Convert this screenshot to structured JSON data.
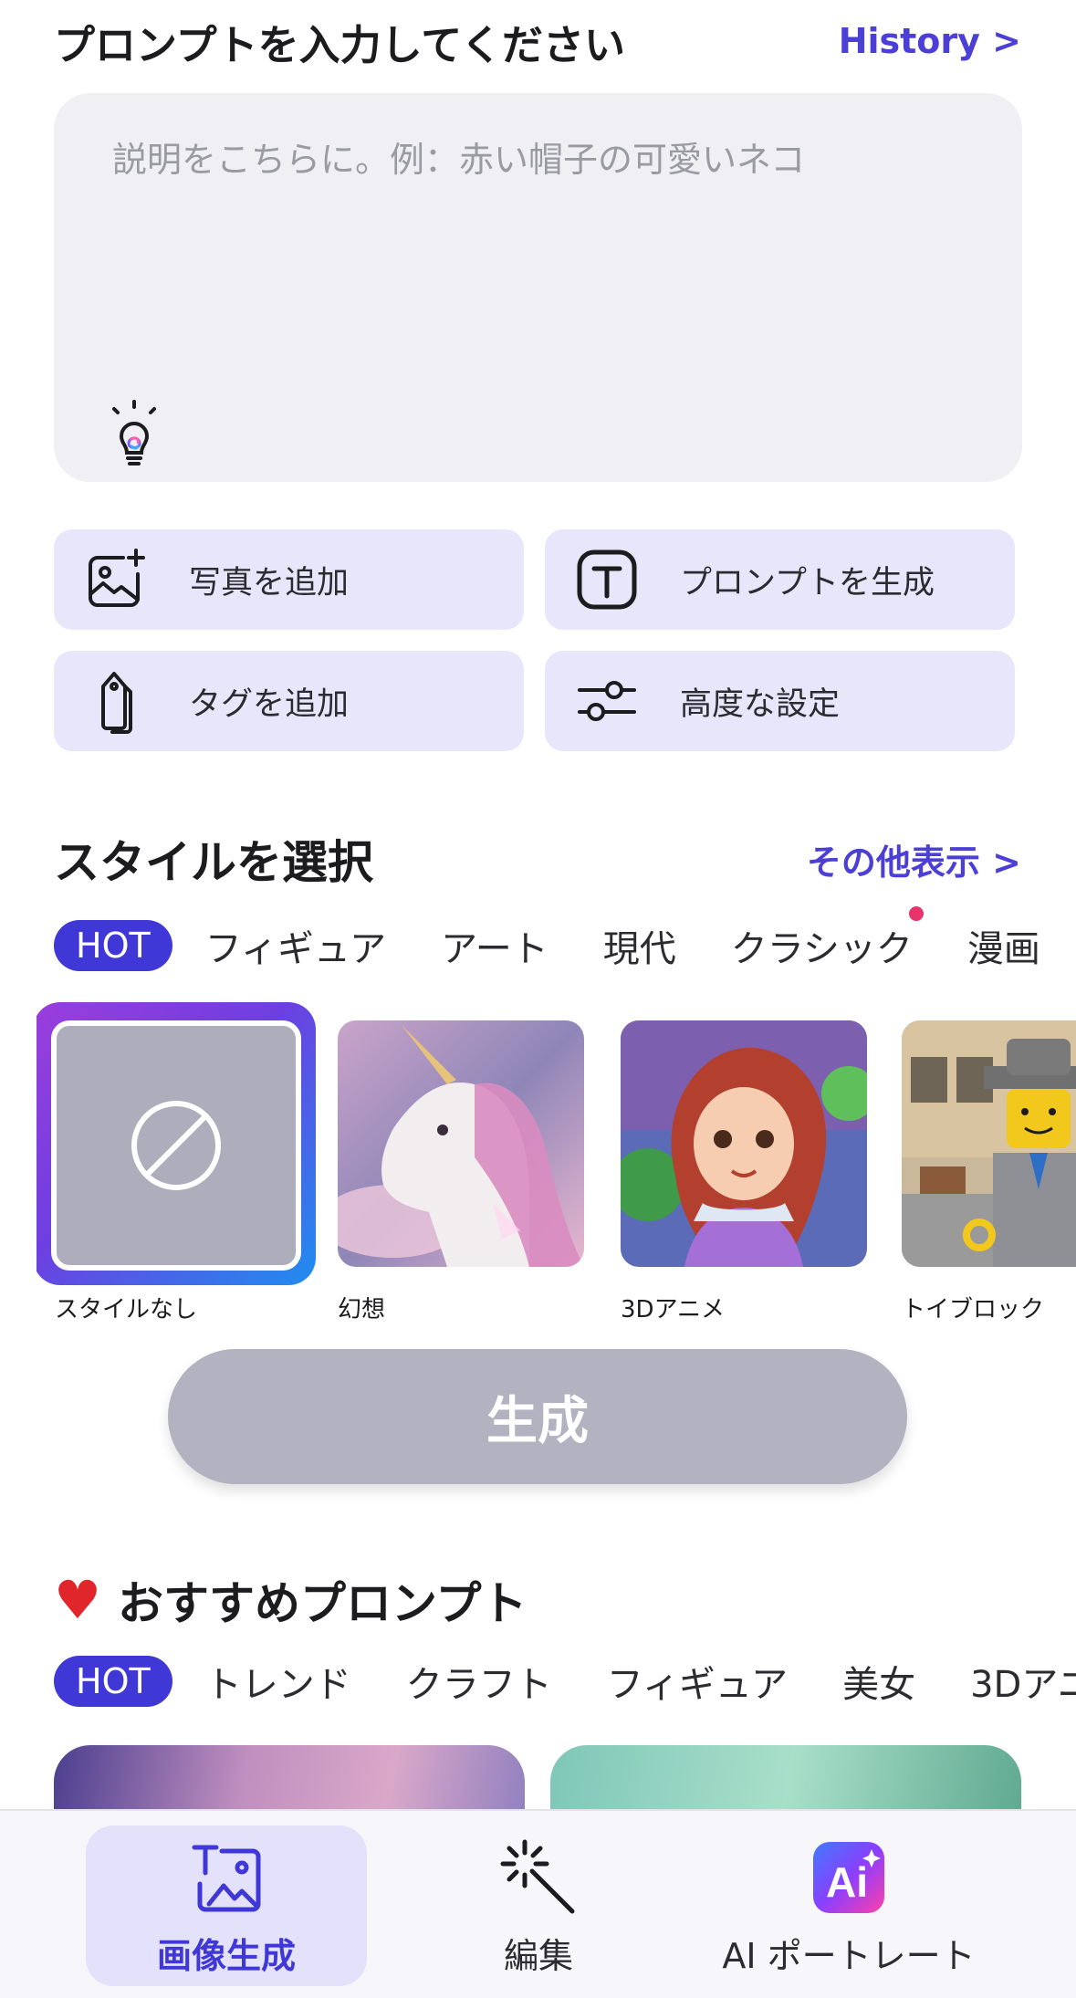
{
  "header": {
    "title": "プロンプトを入力してください",
    "history_link": "History >"
  },
  "prompt": {
    "placeholder": "説明をこちらに。例：赤い帽子の可愛いネコ",
    "hint_icon": "lightbulb-icon"
  },
  "actions": [
    {
      "label": "写真を追加",
      "icon": "add-photo-icon"
    },
    {
      "label": "プロンプトを生成",
      "icon": "text-t-icon"
    },
    {
      "label": "タグを追加",
      "icon": "tag-icon"
    },
    {
      "label": "高度な設定",
      "icon": "sliders-icon"
    }
  ],
  "styles_section": {
    "title": "スタイルを選択",
    "more": "その他表示 >",
    "chips": [
      "HOT",
      "フィギュア",
      "アート",
      "現代",
      "クラシック",
      "漫画"
    ],
    "active_chip": "HOT",
    "cards": [
      {
        "name": "スタイルなし",
        "selected": true
      },
      {
        "name": "幻想"
      },
      {
        "name": "3Dアニメ"
      },
      {
        "name": "トイブロック"
      }
    ]
  },
  "generate_button": {
    "label": "生成"
  },
  "recommend_section": {
    "icon": "heart-icon",
    "title": "おすすめプロンプト",
    "chips": [
      "HOT",
      "トレンド",
      "クラフト",
      "フィギュア",
      "美女",
      "3Dアニ"
    ],
    "active_chip": "HOT"
  },
  "tabbar": {
    "tabs": [
      {
        "label": "画像生成",
        "icon": "image-generate-icon",
        "active": true
      },
      {
        "label": "編集",
        "icon": "magic-wand-icon"
      },
      {
        "label": "AI ポートレート",
        "icon": "ai-portrait-icon"
      }
    ]
  },
  "colors": {
    "accent": "#4038d6",
    "chip_bg": "#e8e6fb",
    "input_bg": "#efeff4",
    "button_disabled": "#b3b2c0"
  }
}
